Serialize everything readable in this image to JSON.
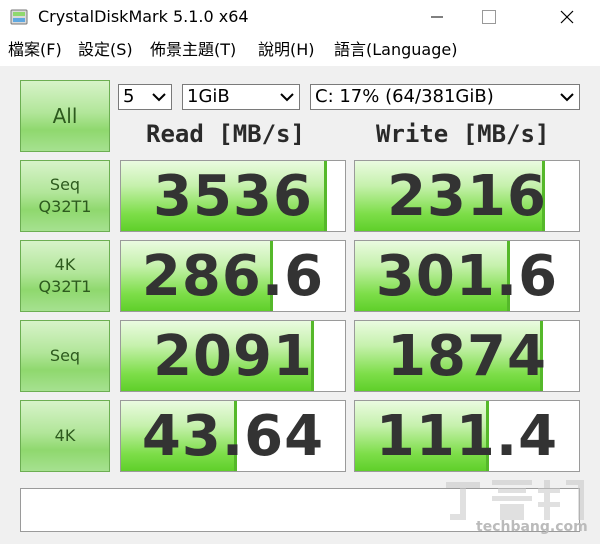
{
  "window": {
    "title": "CrystalDiskMark 5.1.0 x64"
  },
  "menu": [
    "檔案(F)",
    "設定(S)",
    "佈景主題(T)",
    "說明(H)",
    "語言(Language)"
  ],
  "controls": {
    "all_label": "All",
    "count": "5",
    "size": "1GiB",
    "drive": "C: 17% (64/381GiB)"
  },
  "columns": {
    "read": "Read [MB/s]",
    "write": "Write [MB/s]"
  },
  "tests": [
    {
      "line1": "Seq",
      "line2": "Q32T1",
      "read": "3536",
      "write": "2316",
      "read_fill": 0.92,
      "write_fill": 0.85
    },
    {
      "line1": "4K",
      "line2": "Q32T1",
      "read": "286.6",
      "write": "301.6",
      "read_fill": 0.68,
      "write_fill": 0.69
    },
    {
      "line1": "Seq",
      "line2": "",
      "read": "2091",
      "write": "1874",
      "read_fill": 0.86,
      "write_fill": 0.84
    },
    {
      "line1": "4K",
      "line2": "",
      "read": "43.64",
      "write": "111.4",
      "read_fill": 0.52,
      "write_fill": 0.6
    }
  ],
  "watermark": "techbang.com",
  "icons": {
    "app": "disk-icon",
    "minimize": "minimize-icon",
    "maximize": "maximize-icon",
    "close": "close-icon",
    "dropdown": "chevron-down-icon"
  }
}
